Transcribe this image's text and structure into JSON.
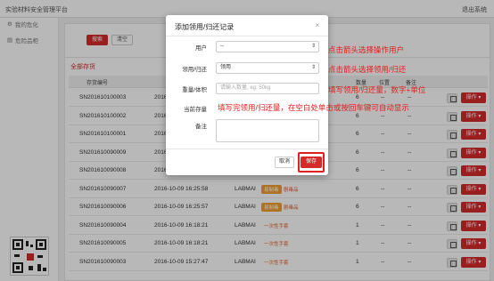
{
  "topbar": {
    "brand": "实验材料安全管理平台",
    "logout": "退出系统"
  },
  "sidebar": {
    "items": [
      "我的危化",
      "危险品柜"
    ],
    "phone": "400-843-4255"
  },
  "filter": {
    "search_label": "搜索",
    "clear_label": "清空"
  },
  "list": {
    "title": "全部存货",
    "headers": [
      "存货编号",
      "创建",
      "数量",
      "位置",
      "备注"
    ],
    "action_label": "操作",
    "rows": [
      {
        "id": "SN201610100003",
        "date": "2016-1",
        "qty": "6",
        "pos": "--",
        "note": "--"
      },
      {
        "id": "SN201610100002",
        "date": "2016-1",
        "qty": "6",
        "pos": "--",
        "note": "--"
      },
      {
        "id": "SN201610100001",
        "date": "2016-1",
        "qty": "6",
        "pos": "--",
        "note": "--"
      },
      {
        "id": "SN201610090009",
        "date": "2016-1",
        "qty": "6",
        "pos": "--",
        "note": "--"
      },
      {
        "id": "SN201610090008",
        "date": "2016-10-09 16:25:57",
        "lab": "LABMAI",
        "qty": "6",
        "pos": "--",
        "note": "--"
      },
      {
        "id": "SN201610090007",
        "date": "2016-10-09 16:25:58",
        "lab": "LABMAI",
        "tag": "易制毒",
        "tag2": "剧毒品",
        "qty": "6",
        "pos": "--",
        "note": "--"
      },
      {
        "id": "SN201610090006",
        "date": "2016-10-09 16:25:57",
        "lab": "LABMAI",
        "tag": "易制毒",
        "tag2": "剧毒品",
        "qty": "6",
        "pos": "--",
        "note": "--"
      },
      {
        "id": "SN201610090004",
        "date": "2016-10-09 16:18:21",
        "lab": "LABMAI",
        "tag2": "一次性手套",
        "qty": "1",
        "pos": "--",
        "note": "--"
      },
      {
        "id": "SN201610090005",
        "date": "2016-10-09 16:18:21",
        "lab": "LABMAI",
        "tag2": "一次性手套",
        "qty": "1",
        "pos": "--",
        "note": "--"
      },
      {
        "id": "SN201610090003",
        "date": "2016-10-09 15:27:47",
        "lab": "LABMAI",
        "tag2": "一次性手套",
        "qty": "1",
        "pos": "--",
        "note": "--"
      }
    ]
  },
  "modal": {
    "title": "添加领用/归还记录",
    "close": "×",
    "fields": {
      "user_label": "用户",
      "user_value": "--",
      "action_label": "领用/归还",
      "action_value": "领用",
      "qty_label": "重量/体积",
      "qty_placeholder": "请输入数量, eg: 50kg",
      "stock_label": "当前存量",
      "note_label": "备注"
    },
    "cancel_label": "取消",
    "save_label": "保存"
  },
  "annotations": {
    "a1": "点击箭头选择操作用户",
    "a2": "点击箭头选择领用/归还",
    "a3": "填写领用/归还量，数字+单位",
    "a4": "填写完领用/归还量，在空白处单击或按回车键可自动显示"
  },
  "colors": {
    "brand_red": "#d52a2a",
    "annotation_red": "#e02020"
  }
}
